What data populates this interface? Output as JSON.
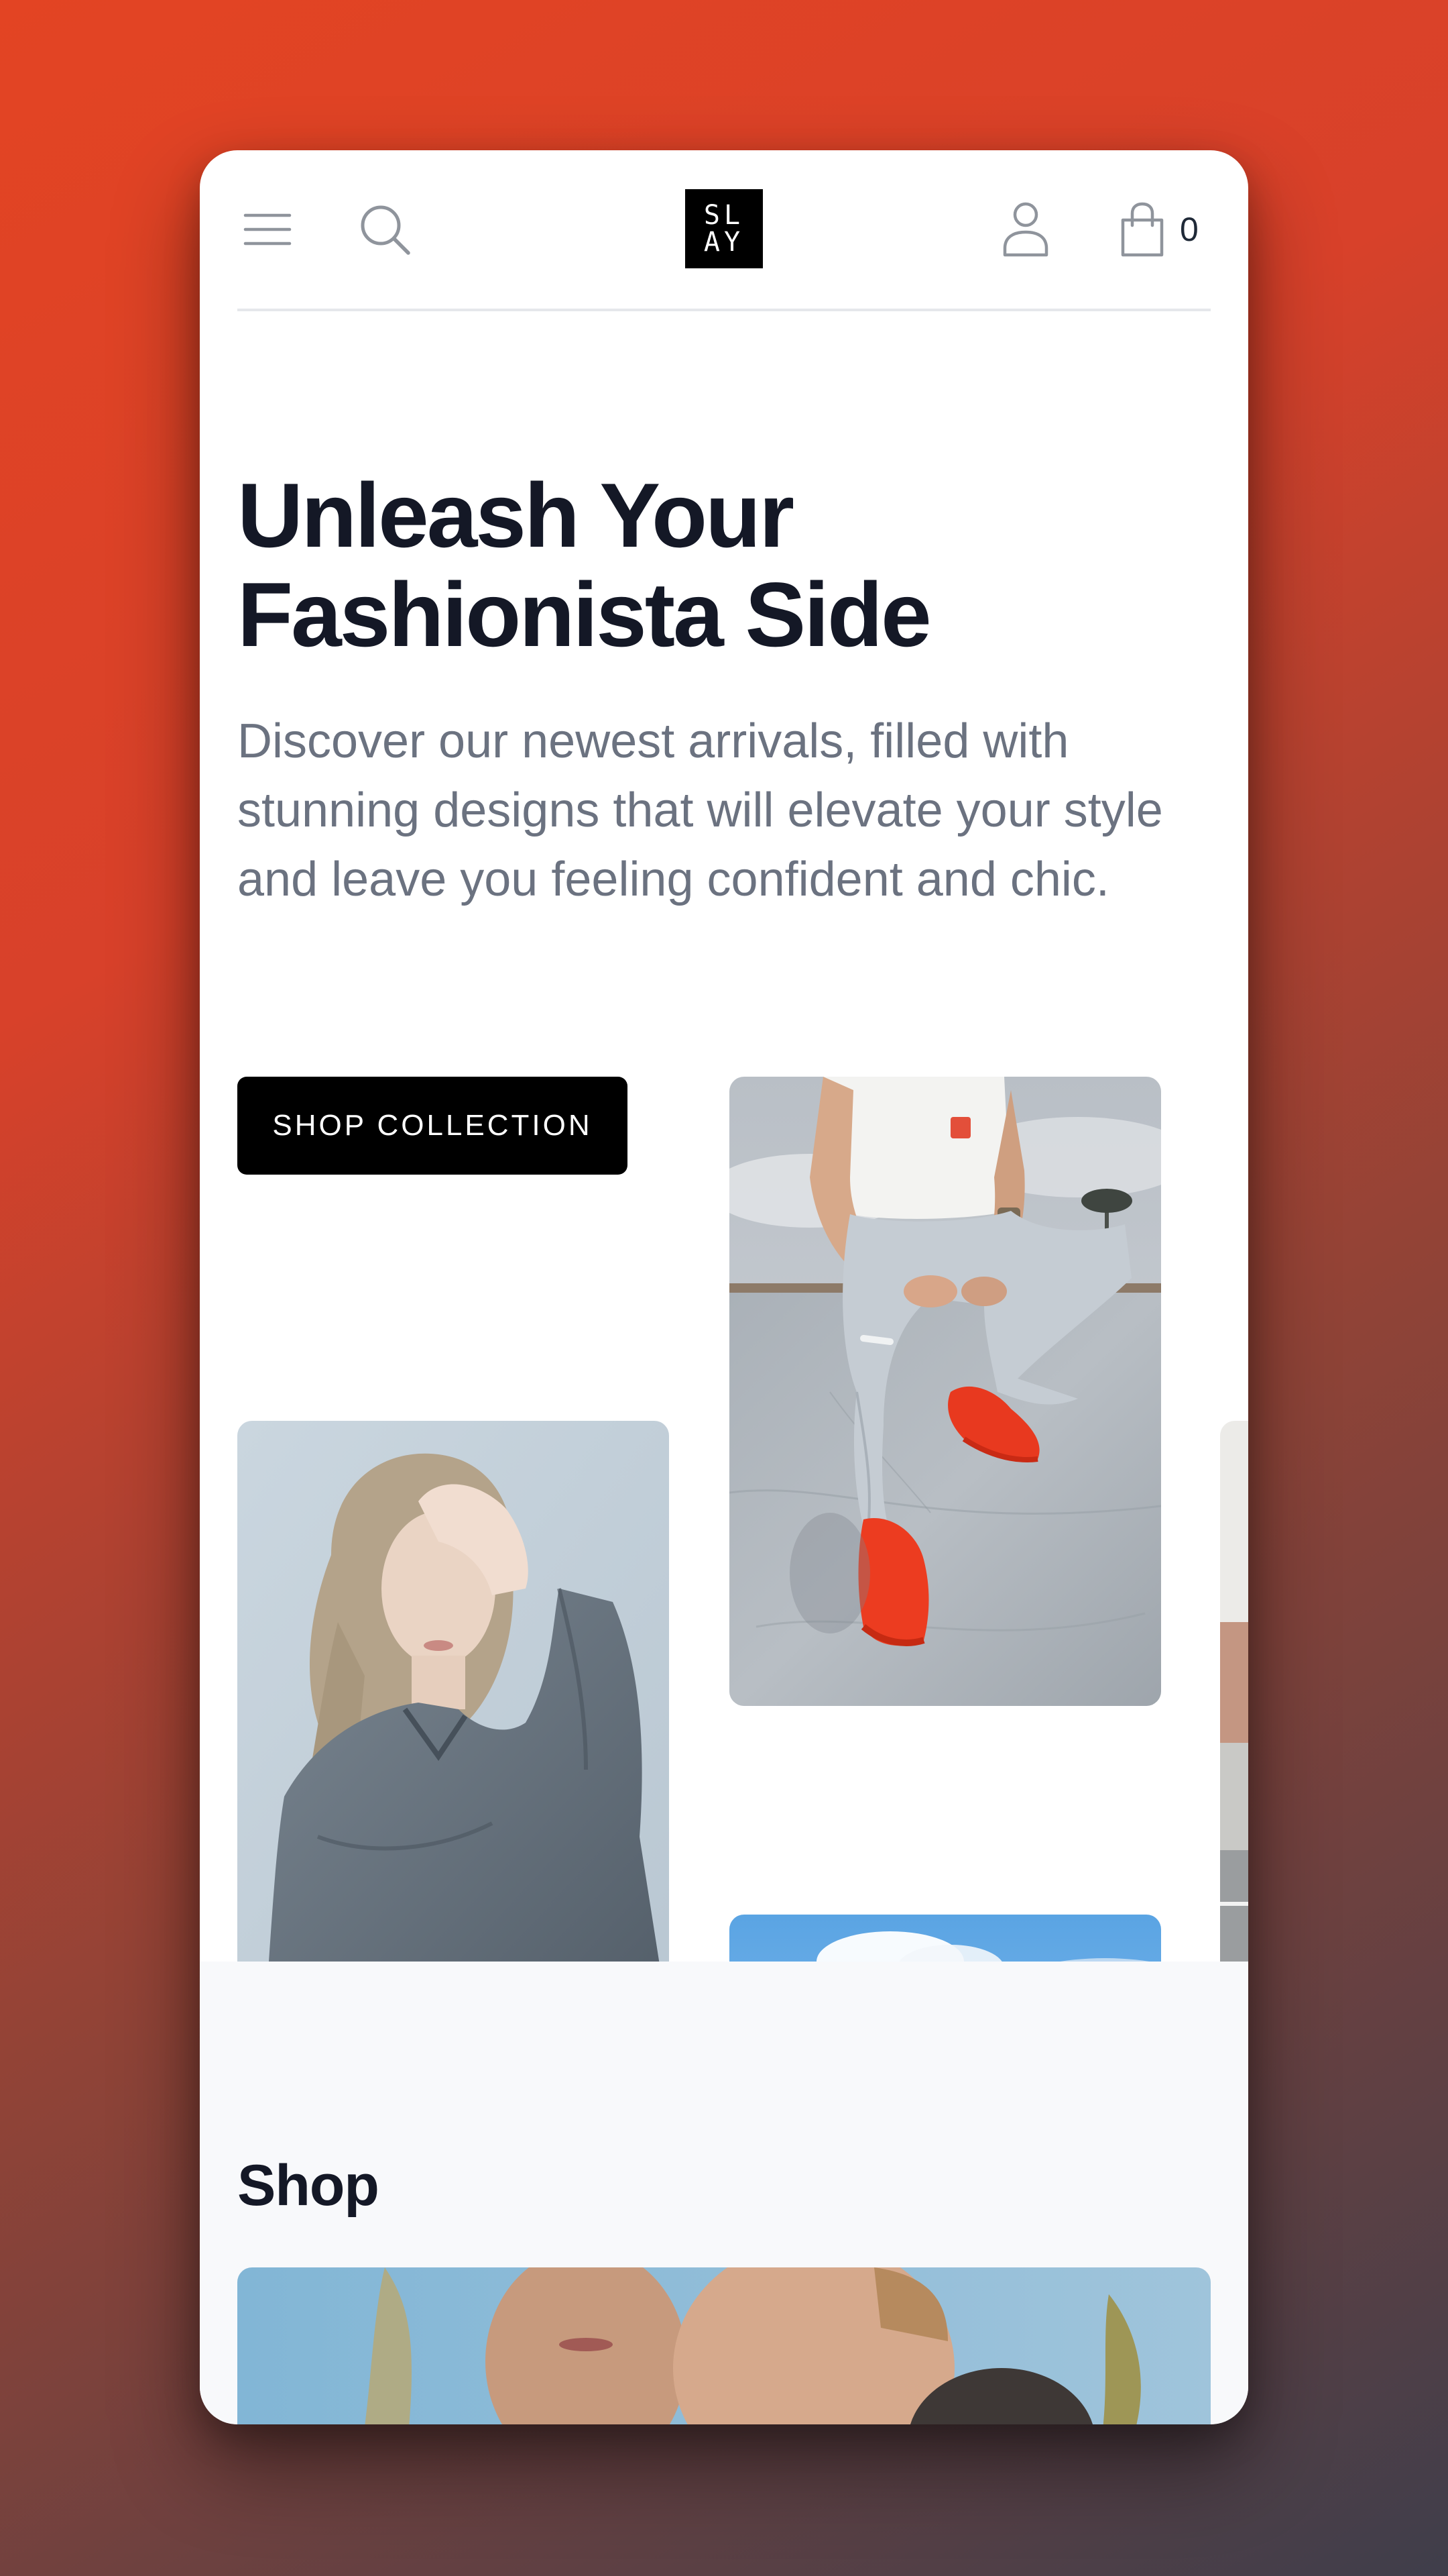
{
  "brand": {
    "logo_line1": "SL",
    "logo_line2": "AY"
  },
  "header": {
    "icons": [
      "menu-icon",
      "search-icon",
      "user-icon",
      "shopping-bag-icon"
    ],
    "cart_count": "0"
  },
  "hero": {
    "title_line1": "Unleash Your",
    "title_line2": "Fashionista Side",
    "description": "Discover our newest arrivals, filled with stunning designs that will elevate your style and leave you feeling confident and chic.",
    "cta_label": "SHOP COLLECTION"
  },
  "shop": {
    "title": "Shop"
  },
  "colors": {
    "background_top": "#e34423",
    "background_bottom": "#3f3e4b",
    "text_dark": "#141826",
    "text_muted": "#6b7280",
    "button_bg": "#000000",
    "section_bg": "#f8f9fb"
  }
}
